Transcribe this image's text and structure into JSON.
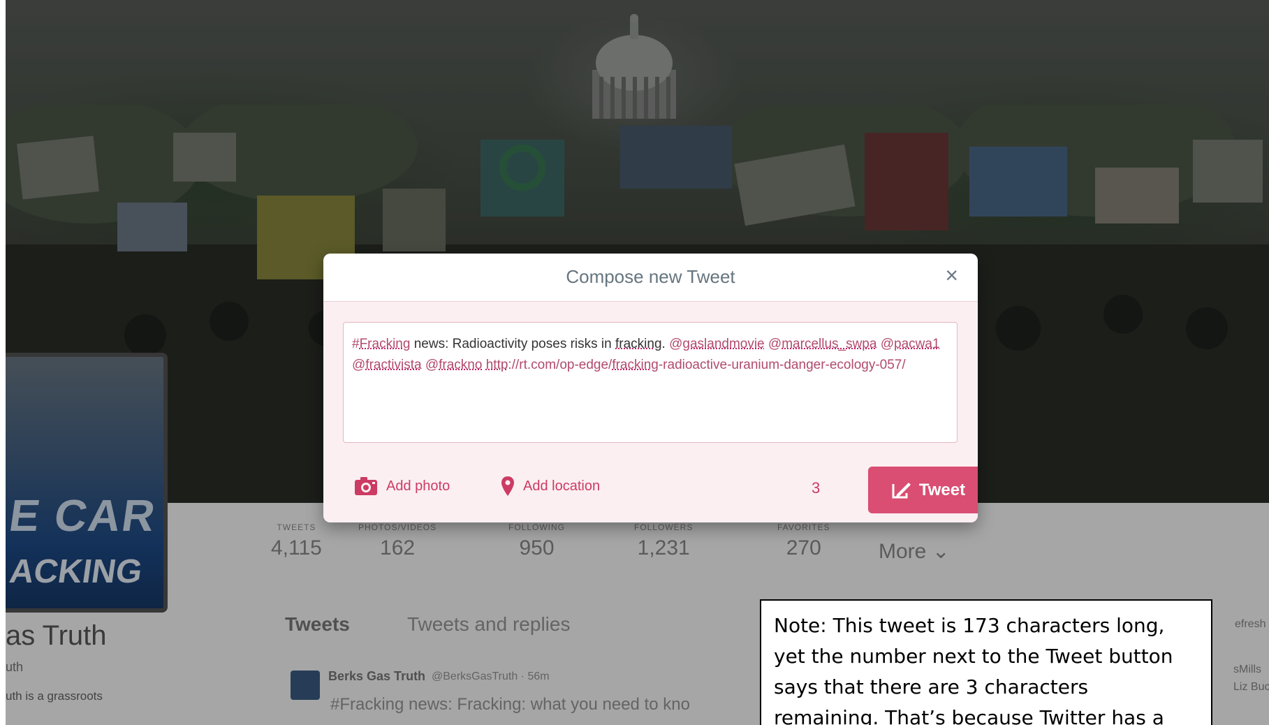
{
  "modal": {
    "title": "Compose new Tweet",
    "close_label": "×",
    "text_parts": [
      {
        "text": "#",
        "cls": "tag"
      },
      {
        "text": "Fracking",
        "cls": "tag u"
      },
      {
        "text": " news: Radioactivity poses risks in ",
        "cls": ""
      },
      {
        "text": "fracking",
        "cls": "u"
      },
      {
        "text": ". ",
        "cls": ""
      },
      {
        "text": "@",
        "cls": "tag"
      },
      {
        "text": "gaslandmovie",
        "cls": "tag u"
      },
      {
        "text": " ",
        "cls": ""
      },
      {
        "text": "@",
        "cls": "tag"
      },
      {
        "text": "marcellus_swpa",
        "cls": "tag u"
      },
      {
        "text": " ",
        "cls": ""
      },
      {
        "text": "@",
        "cls": "tag"
      },
      {
        "text": "pacwa1",
        "cls": "tag u"
      },
      {
        "text": " ",
        "cls": ""
      },
      {
        "text": "@",
        "cls": "tag"
      },
      {
        "text": "fractivista",
        "cls": "tag u"
      },
      {
        "text": " ",
        "cls": ""
      },
      {
        "text": "@",
        "cls": "tag"
      },
      {
        "text": "frackno",
        "cls": "tag u"
      },
      {
        "text": " ",
        "cls": ""
      },
      {
        "text": "http",
        "cls": "tag u"
      },
      {
        "text": "://rt.com/op-edge/",
        "cls": "tag"
      },
      {
        "text": "fracking",
        "cls": "tag u"
      },
      {
        "text": "-radioactive-uranium-danger-ecology-057/",
        "cls": "tag"
      }
    ],
    "add_photo_label": "Add photo",
    "add_location_label": "Add location",
    "char_counter": "3",
    "tweet_button_label": "Tweet",
    "accent_color": "#d94e72"
  },
  "stats": [
    {
      "label": "TWEETS",
      "value": "4,115"
    },
    {
      "label": "PHOTOS/VIDEOS",
      "value": "162"
    },
    {
      "label": "FOLLOWING",
      "value": "950"
    },
    {
      "label": "FOLLOWERS",
      "value": "1,231"
    },
    {
      "label": "FAVORITES",
      "value": "270"
    }
  ],
  "more_label": "More ⌄",
  "profile": {
    "name": "as Truth",
    "handle": "uth",
    "bio": "uth is a grassroots"
  },
  "profile_banner_text": {
    "line1": "E CAR",
    "line2": "ACKING"
  },
  "tabs": {
    "tweets": "Tweets",
    "replies": "Tweets and replies"
  },
  "timeline_tweet": {
    "author": "Berks Gas Truth",
    "handle": "@BerksGasTruth · 56m",
    "text": "#Fracking news: Fracking: what you need to kno"
  },
  "sidebar_right": {
    "refresh": "efresh · V",
    "user": "sMills",
    "user2": "Liz Buca"
  },
  "note": "Note: This tweet is 173 characters long, yet the number next to the Tweet button says that there are 3 characters remaining. That’s because Twitter has a"
}
